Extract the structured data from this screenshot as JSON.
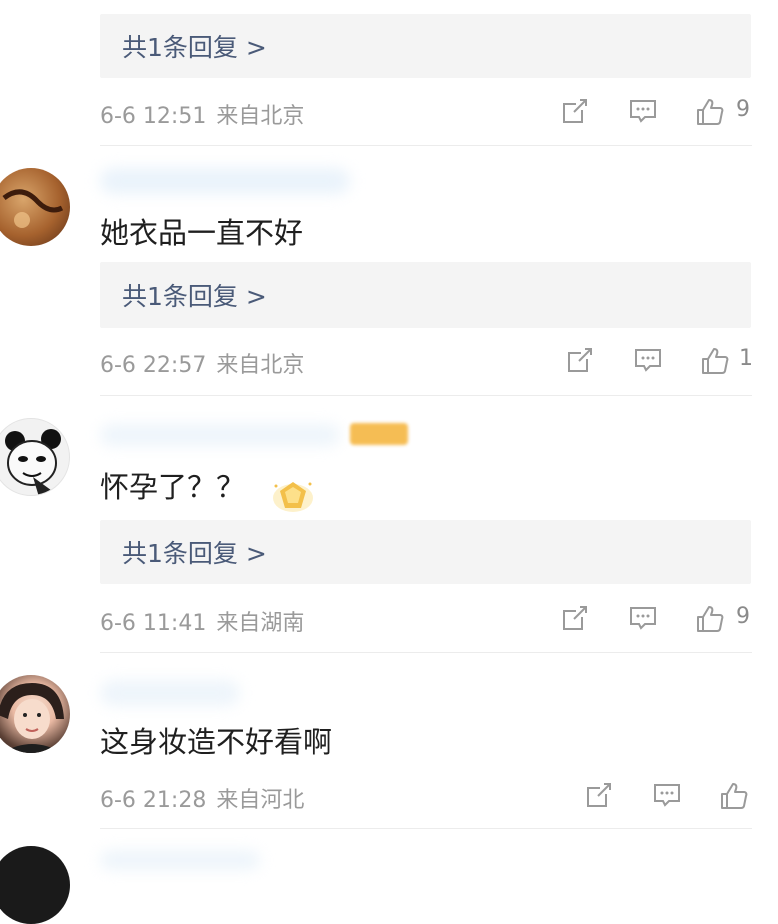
{
  "comments": [
    {
      "text": "",
      "replies": "共1条回复 >",
      "date": "6-6 12:51",
      "location": "来自北京",
      "likes": "9"
    },
    {
      "text": "她衣品一直不好",
      "replies": "共1条回复 >",
      "date": "6-6 22:57",
      "location": "来自北京",
      "likes": "1"
    },
    {
      "text": "怀孕了？？",
      "replies": "共1条回复 >",
      "date": "6-6 11:41",
      "location": "来自湖南",
      "likes": "9"
    },
    {
      "text": "这身妆造不好看啊",
      "replies": "",
      "date": "6-6 21:28",
      "location": "来自河北",
      "likes": ""
    }
  ],
  "icons": {
    "share": "share-icon",
    "comment": "comment-icon",
    "like": "thumbs-up-icon"
  },
  "colors": {
    "reply_link": "#4a5a78",
    "meta_gray": "#9a9a9a",
    "badge_gold": "#f5b642"
  }
}
